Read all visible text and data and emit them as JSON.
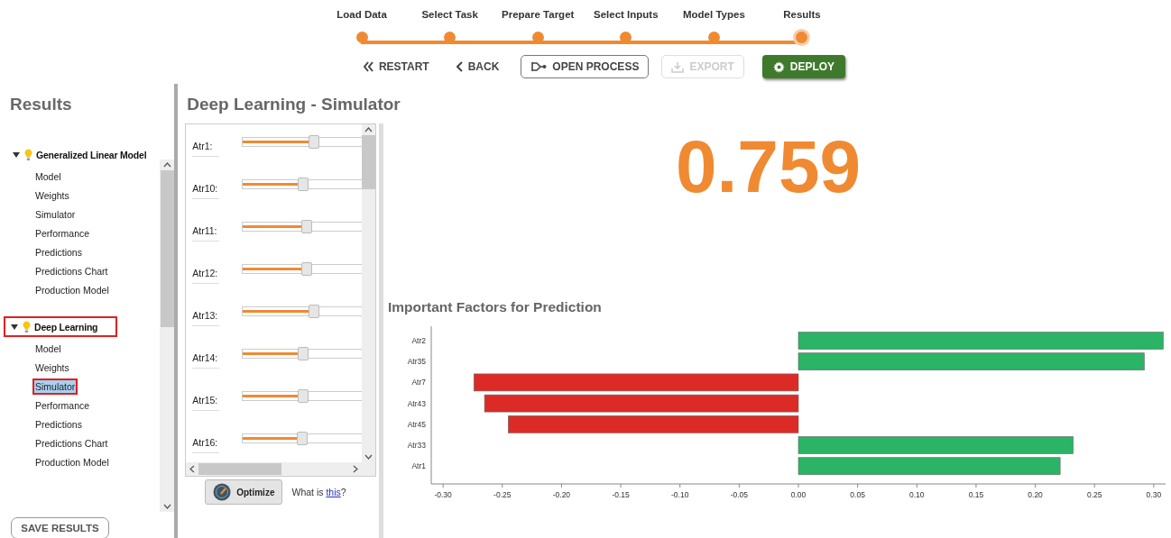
{
  "stepper": [
    {
      "label": "Load Data",
      "selected": false
    },
    {
      "label": "Select Task",
      "selected": false
    },
    {
      "label": "Prepare Target",
      "selected": false
    },
    {
      "label": "Select Inputs",
      "selected": false
    },
    {
      "label": "Model Types",
      "selected": false
    },
    {
      "label": "Results",
      "selected": true
    }
  ],
  "actions": [
    {
      "label": "RESTART",
      "kind": "restart",
      "disabled": false
    },
    {
      "label": "BACK",
      "kind": "back",
      "disabled": false
    },
    {
      "label": "OPEN PROCESS",
      "kind": "process",
      "disabled": false
    },
    {
      "label": "EXPORT",
      "kind": "export",
      "disabled": true
    },
    {
      "label": "DEPLOY",
      "kind": "deploy",
      "disabled": false
    }
  ],
  "sidebar": {
    "title": "Results",
    "tree": [
      {
        "label": "Generalized Linear Model",
        "expanded": true,
        "highlighted": false,
        "children": [
          {
            "label": "Model",
            "selected": false,
            "highlighted": false
          },
          {
            "label": "Weights",
            "selected": false,
            "highlighted": false
          },
          {
            "label": "Simulator",
            "selected": false,
            "highlighted": false
          },
          {
            "label": "Performance",
            "selected": false,
            "highlighted": false
          },
          {
            "label": "Predictions",
            "selected": false,
            "highlighted": false
          },
          {
            "label": "Predictions Chart",
            "selected": false,
            "highlighted": false
          },
          {
            "label": "Production Model",
            "selected": false,
            "highlighted": false
          }
        ]
      },
      {
        "label": "Deep Learning",
        "expanded": true,
        "highlighted": true,
        "children": [
          {
            "label": "Model",
            "selected": false,
            "highlighted": false
          },
          {
            "label": "Weights",
            "selected": false,
            "highlighted": false
          },
          {
            "label": "Simulator",
            "selected": true,
            "highlighted": true
          },
          {
            "label": "Performance",
            "selected": false,
            "highlighted": false
          },
          {
            "label": "Predictions",
            "selected": false,
            "highlighted": false
          },
          {
            "label": "Predictions Chart",
            "selected": false,
            "highlighted": false
          },
          {
            "label": "Production Model",
            "selected": false,
            "highlighted": false
          }
        ]
      }
    ],
    "save_button": "SAVE RESULTS"
  },
  "simulator": {
    "title": "Deep Learning - Simulator",
    "inputs": [
      {
        "label": "Atr1:",
        "level": 0.59
      },
      {
        "label": "Atr10:",
        "level": 0.5
      },
      {
        "label": "Atr11:",
        "level": 0.53
      },
      {
        "label": "Atr12:",
        "level": 0.53
      },
      {
        "label": "Atr13:",
        "level": 0.59
      },
      {
        "label": "Atr14:",
        "level": 0.5
      },
      {
        "label": "Atr15:",
        "level": 0.5
      },
      {
        "label": "Atr16:",
        "level": 0.49
      }
    ],
    "optimize_button": "Optimize",
    "help_text": "What is ",
    "help_link": "this",
    "help_suffix": "?"
  },
  "prediction": {
    "value": "0.759"
  },
  "factors": {
    "title": "Important Factors for Prediction",
    "chart_data": {
      "type": "bar",
      "orientation": "horizontal",
      "stacked": true,
      "categories": [
        "Atr2",
        "Atr35",
        "Atr7",
        "Atr43",
        "Atr45",
        "Atr33",
        "Atr1"
      ],
      "series": [
        {
          "color": "#2bb366",
          "values": [
            0.308,
            0.292,
            null,
            null,
            null,
            0.232,
            0.221
          ]
        },
        {
          "color": "#dc2b26",
          "values": [
            null,
            null,
            -0.274,
            -0.265,
            -0.245,
            null,
            null
          ]
        }
      ],
      "xlim": [
        -0.31,
        0.31
      ],
      "xticks": [
        {
          "value": -0.3,
          "label": "-0.30"
        },
        {
          "value": -0.25,
          "label": "-0.25"
        },
        {
          "value": -0.2,
          "label": "-0.20"
        },
        {
          "value": -0.15,
          "label": "-0.15"
        },
        {
          "value": -0.1,
          "label": "-0.10"
        },
        {
          "value": -0.05,
          "label": "-0.05"
        },
        {
          "value": 0,
          "label": "0.00"
        },
        {
          "value": 0.05,
          "label": "0.05"
        },
        {
          "value": 0.1,
          "label": "0.10"
        },
        {
          "value": 0.15,
          "label": "0.15"
        },
        {
          "value": 0.2,
          "label": "0.20"
        },
        {
          "value": 0.25,
          "label": "0.25"
        },
        {
          "value": 0.3,
          "label": "0.30"
        }
      ]
    }
  }
}
